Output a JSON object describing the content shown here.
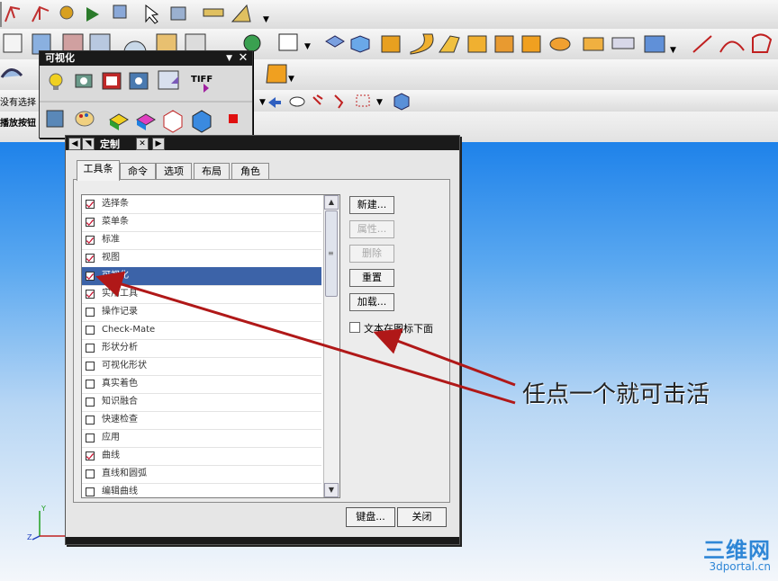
{
  "floating_toolbar": {
    "title": "可视化",
    "tiff_label": "TIFF"
  },
  "left_labels": {
    "selection": "没有选择",
    "play": "播放按钮"
  },
  "dialog": {
    "title": "定制",
    "tabs": [
      "工具条",
      "命令",
      "选项",
      "布局",
      "角色"
    ],
    "selected_tab": "工具条",
    "toolbars": [
      {
        "label": "选择条",
        "checked": true
      },
      {
        "label": "菜单条",
        "checked": true
      },
      {
        "label": "标准",
        "checked": true
      },
      {
        "label": "视图",
        "checked": true
      },
      {
        "label": "可视化",
        "checked": true,
        "selected": true
      },
      {
        "label": "实用工具",
        "checked": true
      },
      {
        "label": "操作记录",
        "checked": false
      },
      {
        "label": "Check-Mate",
        "checked": false
      },
      {
        "label": "形状分析",
        "checked": false
      },
      {
        "label": "可视化形状",
        "checked": false
      },
      {
        "label": "真实着色",
        "checked": false
      },
      {
        "label": "知识融合",
        "checked": false
      },
      {
        "label": "快速检查",
        "checked": false
      },
      {
        "label": "应用",
        "checked": false
      },
      {
        "label": "曲线",
        "checked": true
      },
      {
        "label": "直线和圆弧",
        "checked": false
      },
      {
        "label": "编辑曲线",
        "checked": false
      }
    ],
    "buttons": {
      "new": "新建...",
      "properties": "属性...",
      "delete": "删除",
      "reset": "重置",
      "load": "加载..."
    },
    "text_below_icon": "文本在图标下面",
    "keyboard": "键盘...",
    "close": "关闭"
  },
  "annotation": "任点一个就可击活",
  "axis_labels": {
    "y": "Y",
    "z": "Z"
  },
  "watermark": {
    "big": "三维网",
    "small": "3dportal.cn"
  },
  "colors": {
    "selection": "#3c63a8",
    "arrow": "#b01818",
    "check": "#c8102e"
  }
}
